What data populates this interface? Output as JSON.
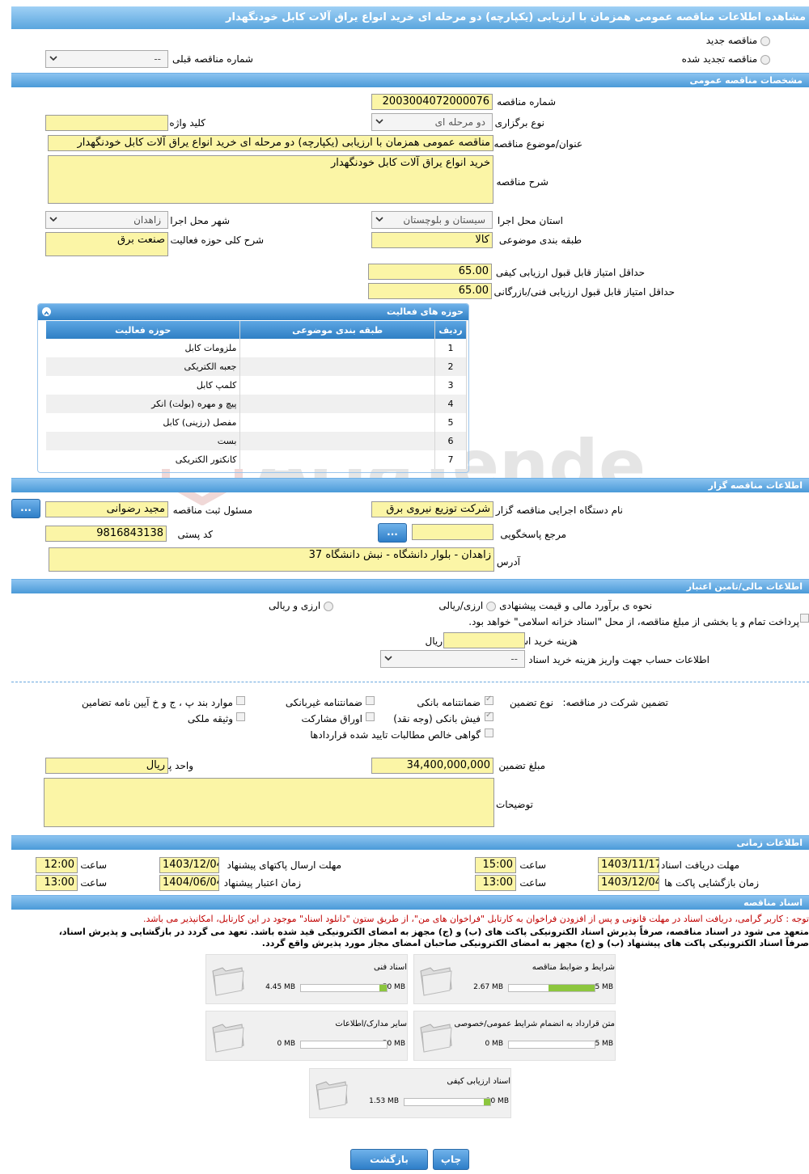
{
  "title": "مشاهده اطلاعات مناقصه عمومی همزمان با ارزیابی (یکپارچه) دو مرحله ای خرید انواع یراق آلات کابل خودنگهدار",
  "top": {
    "new_tender": "مناقصه جدید",
    "renewed_tender": "مناقصه تجدید شده",
    "prev_number_label": "شماره مناقصه قبلی",
    "prev_number_value": "--"
  },
  "general": {
    "section_title": "مشخصات مناقصه عمومی",
    "number_label": "شماره مناقصه",
    "number_value": "2003004072000076",
    "type_label": "نوع برگزاری",
    "type_value": "دو مرحله ای",
    "keyword_label": "کلید واژه",
    "keyword_value": "",
    "subject_label": "عنوان/موضوع مناقصه",
    "subject_value": "مناقصه عمومی همزمان با ارزیابی (یکپارچه) دو مرحله ای خرید انواع یراق آلات کابل خودنگهدار",
    "desc_label": "شرح مناقصه",
    "desc_value": "خرید انواع یراق آلات کابل خودنگهدار",
    "province_label": "استان محل اجرا",
    "province_value": "سیستان و بلوچستان",
    "city_label": "شهر محل اجرا",
    "city_value": "زاهدان",
    "category_label": "طبقه بندی موضوعی",
    "category_value": "کالا",
    "activity_label": "شرح کلی حوزه فعالیت",
    "activity_value": "صنعت برق",
    "min_quality_label": "حداقل امتیاز قابل قبول ارزیابی کیفی",
    "min_quality_value": "65.00",
    "min_tech_label": "حداقل امتیاز قابل قبول ارزیابی فنی/بازرگانی",
    "min_tech_value": "65.00"
  },
  "activities": {
    "panel_title": "حوزه های فعالیت",
    "headers": [
      "ردیف",
      "طبقه بندی موضوعی",
      "حوزه فعالیت"
    ],
    "rows": [
      [
        "1",
        "",
        "ملزومات کابل"
      ],
      [
        "2",
        "",
        "جعبه الکتریکی"
      ],
      [
        "3",
        "",
        "کلمپ کابل"
      ],
      [
        "4",
        "",
        "پیچ و مهره (بولت) انکر"
      ],
      [
        "5",
        "",
        "مفصل (رزینی) کابل"
      ],
      [
        "6",
        "",
        "بست"
      ],
      [
        "7",
        "",
        "کانکتور الکتریکی"
      ]
    ]
  },
  "organizer": {
    "section_title": "اطلاعات مناقصه گزار",
    "org_label": "نام دستگاه اجرایی مناقصه گزار",
    "org_value": "شرکت توزیع نیروی برق",
    "officer_label": "مسئول ثبت مناقصه",
    "officer_value": "مجید رضوانی",
    "ref_label": "مرجع پاسخگویی",
    "ref_value": "",
    "postal_label": "کد پستی",
    "postal_value": "9816843138",
    "address_label": "آدرس",
    "address_value": "زاهدان - بلوار دانشگاه - نبش دانشگاه 37",
    "dots": "..."
  },
  "finance": {
    "section_title": "اطلاعات مالی/تامین اعتبار",
    "method_label": "نحوه ی برآورد مالی و قیمت پیشنهادی",
    "opt1": "ارزی/ریالی",
    "opt2": "ارزی و ریالی",
    "treasury_text": "پرداخت تمام و یا بخشی از مبلغ مناقصه، از محل \"اسناد خزانه اسلامی\" خواهد بود.",
    "doc_cost_label": "هزینه خرید اسناد",
    "doc_cost_value": "",
    "rial": "ریال",
    "account_label": "اطلاعات حساب جهت واریز هزینه خرید اسناد",
    "account_value": "--"
  },
  "guarantee": {
    "label": "تضمین شرکت در مناقصه:",
    "type_label": "نوع تضمین",
    "bank_guarantee": "ضمانتنامه بانکی",
    "non_bank_guarantee": "ضمانتنامه غیربانکی",
    "clauses": "موارد بند پ ، ج و خ آیین نامه تضامین",
    "bank_receipt": "فیش بانکی (وجه نقد)",
    "bonds": "اوراق مشارکت",
    "property": "وثیقه ملکی",
    "net_claims": "گواهی خالص مطالبات تایید شده قراردادها",
    "amount_label": "مبلغ تضمین",
    "amount_value": "34,400,000,000",
    "currency_label": "واحد پول",
    "currency_value": "ریال",
    "notes_label": "توضیحات",
    "notes_value": ""
  },
  "timing": {
    "section_title": "اطلاعات زمانی",
    "receive_label": "مهلت دریافت اسناد",
    "receive_date": "1403/11/17",
    "receive_time": "15:00",
    "send_label": "مهلت ارسال پاکتهای پیشنهاد",
    "send_date": "1403/12/04",
    "send_time": "12:00",
    "open_label": "زمان بازگشایی پاکت ها",
    "open_date": "1403/12/04",
    "open_time": "13:00",
    "validity_label": "زمان اعتبار پیشنهاد",
    "validity_date": "1404/06/04",
    "validity_time": "13:00",
    "time_label": "ساعت"
  },
  "docs": {
    "section_title": "اسناد مناقصه",
    "note_red": "توجه : کاربر گرامی، دریافت اسناد در مهلت قانونی و پس از افزودن فراخوان به کارتابل \"فراخوان های من\"، از طریق ستون \"دانلود اسناد\" موجود در این کارتابل، امکانپذیر می باشد.",
    "note_bold1": "متعهد می شود در اسناد مناقصه، صرفاً پذیرش اسناد الکترونیکی پاکت های (ب) و (ج) مجهز به امضای الکترونیکی قید شده باشد. تعهد می گردد در بازگشایی و پذیرش اسناد،",
    "note_bold2": "صرفاً اسناد الکترونیکی پاکت های پیشنهاد (ب) و (ج) مجهز به امضای الکترونیکی صاحبان امضای مجاز مورد پذیرش واقع گردد.",
    "files": [
      {
        "name": "شرایط و ضوابط مناقصه",
        "size": "2.67 MB",
        "max": "5 MB",
        "fraction": 0.534
      },
      {
        "name": "اسناد فنی",
        "size": "4.45 MB",
        "max": "50 MB",
        "fraction": 0.089
      },
      {
        "name": "متن قرارداد به انضمام شرایط عمومی/خصوصی",
        "size": "0 MB",
        "max": "5 MB",
        "fraction": 0
      },
      {
        "name": "سایر مدارک/اطلاعات",
        "size": "0 MB",
        "max": "50 MB",
        "fraction": 0
      },
      {
        "name": "اسناد ارزیابی کیفی",
        "size": "1.53 MB",
        "max": "20 MB",
        "fraction": 0.077
      }
    ]
  },
  "buttons": {
    "print": "چاپ",
    "back": "بازگشت"
  },
  "watermark": "AriaTender.neT",
  "colors": {
    "field": "#fbf5a6",
    "accent": "#4a9ad8",
    "progress": "#8cc63e",
    "note": "#c00000"
  }
}
